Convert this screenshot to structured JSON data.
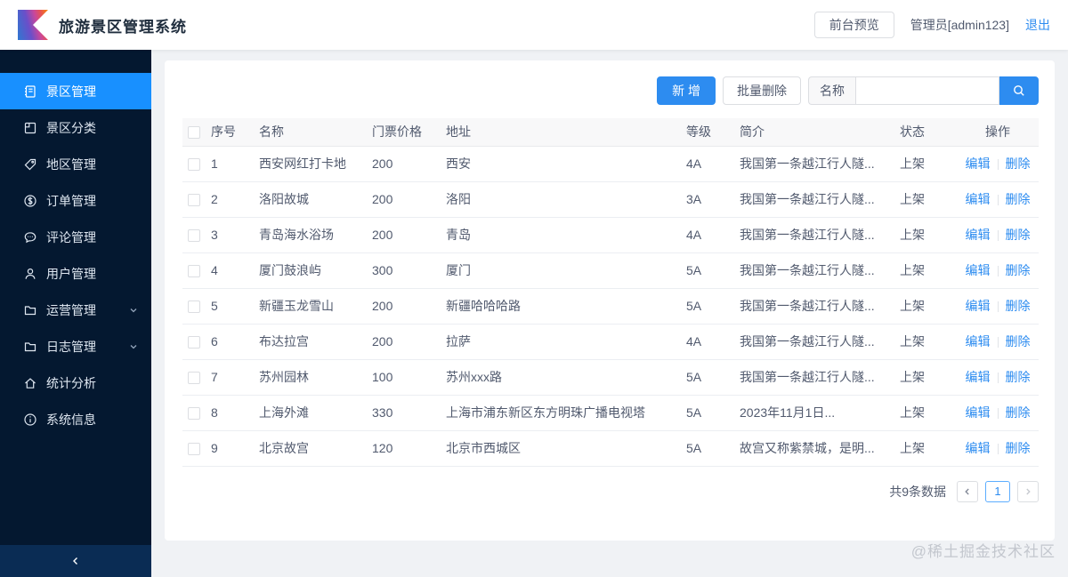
{
  "header": {
    "title": "旅游景区管理系统",
    "preview_button": "前台预览",
    "user": "管理员[admin123]",
    "logout": "退出"
  },
  "sidebar": {
    "items": [
      {
        "label": "景区管理",
        "icon": "notebook-icon",
        "active": true
      },
      {
        "label": "景区分类",
        "icon": "category-icon"
      },
      {
        "label": "地区管理",
        "icon": "tag-icon"
      },
      {
        "label": "订单管理",
        "icon": "money-icon"
      },
      {
        "label": "评论管理",
        "icon": "comment-icon"
      },
      {
        "label": "用户管理",
        "icon": "user-icon"
      },
      {
        "label": "运营管理",
        "icon": "folder-icon",
        "expandable": true
      },
      {
        "label": "日志管理",
        "icon": "folder-icon",
        "expandable": true
      },
      {
        "label": "统计分析",
        "icon": "home-icon"
      },
      {
        "label": "系统信息",
        "icon": "info-icon"
      }
    ],
    "collapse_icon": "chevron-left-icon"
  },
  "toolbar": {
    "add_label": "新 增",
    "batch_delete_label": "批量删除",
    "search_field_label": "名称",
    "search_value": "",
    "search_icon": "search-icon"
  },
  "table": {
    "columns": [
      "序号",
      "名称",
      "门票价格",
      "地址",
      "等级",
      "简介",
      "状态",
      "操作"
    ],
    "edit_label": "编辑",
    "delete_label": "删除",
    "rows": [
      {
        "no": "1",
        "name": "西安网红打卡地",
        "price": "200",
        "address": "西安",
        "level": "4A",
        "intro": "我国第一条越江行人隧...",
        "status": "上架"
      },
      {
        "no": "2",
        "name": "洛阳故城",
        "price": "200",
        "address": "洛阳",
        "level": "3A",
        "intro": "我国第一条越江行人隧...",
        "status": "上架"
      },
      {
        "no": "3",
        "name": "青岛海水浴场",
        "price": "200",
        "address": "青岛",
        "level": "4A",
        "intro": "我国第一条越江行人隧...",
        "status": "上架"
      },
      {
        "no": "4",
        "name": "厦门鼓浪屿",
        "price": "300",
        "address": "厦门",
        "level": "5A",
        "intro": "我国第一条越江行人隧...",
        "status": "上架"
      },
      {
        "no": "5",
        "name": "新疆玉龙雪山",
        "price": "200",
        "address": "新疆哈哈哈路",
        "level": "5A",
        "intro": "我国第一条越江行人隧...",
        "status": "上架"
      },
      {
        "no": "6",
        "name": "布达拉宫",
        "price": "200",
        "address": "拉萨",
        "level": "4A",
        "intro": "我国第一条越江行人隧...",
        "status": "上架"
      },
      {
        "no": "7",
        "name": "苏州园林",
        "price": "100",
        "address": "苏州xxx路",
        "level": "5A",
        "intro": "我国第一条越江行人隧...",
        "status": "上架"
      },
      {
        "no": "8",
        "name": "上海外滩",
        "price": "330",
        "address": "上海市浦东新区东方明珠广播电视塔",
        "level": "5A",
        "intro": "2023年11月1日...",
        "status": "上架"
      },
      {
        "no": "9",
        "name": "北京故宫",
        "price": "120",
        "address": "北京市西城区",
        "level": "5A",
        "intro": "故宫又称紫禁城，是明...",
        "status": "上架"
      }
    ]
  },
  "pagination": {
    "total_text": "共9条数据",
    "current_page": "1"
  },
  "watermark": "@稀土掘金技术社区",
  "colors": {
    "accent": "#2d8cf0",
    "sidebar_bg": "#041830",
    "sidebar_active": "#1890ff",
    "content_bg": "#f0f2f5",
    "header_bg": "#ffffff",
    "table_header_bg": "#f8f8f9",
    "border": "#dcdee2",
    "link": "#2d8cf0",
    "watermark": "#c3c7ce"
  }
}
